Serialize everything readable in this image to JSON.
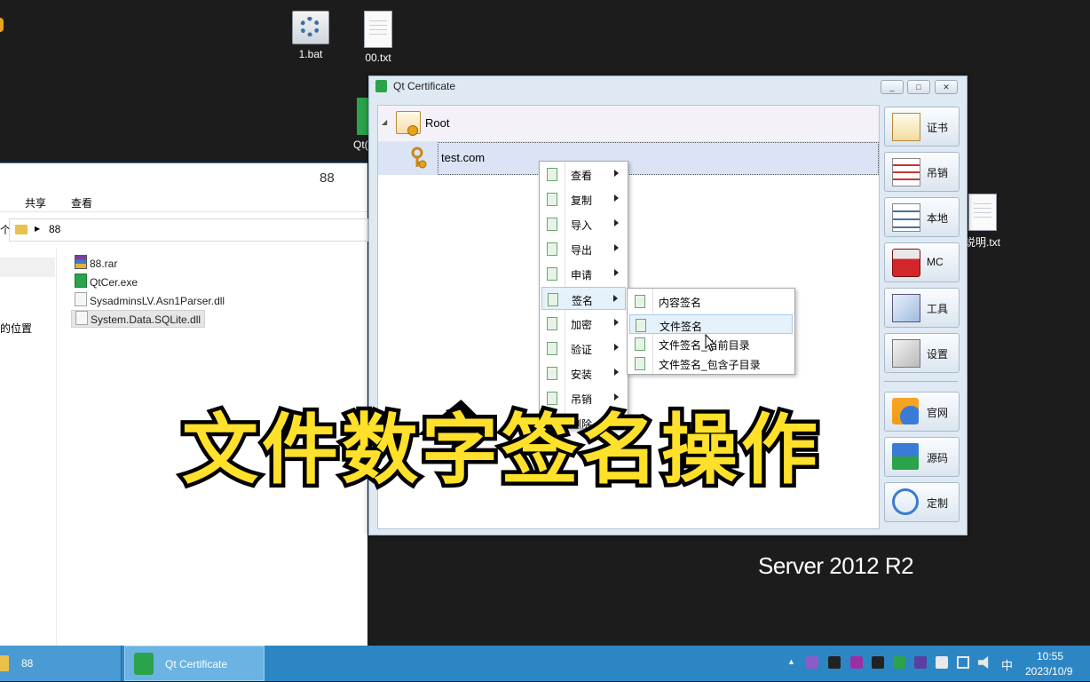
{
  "desktop": {
    "icons": [
      {
        "label": "1.bat"
      },
      {
        "label": "00.txt"
      },
      {
        "label": "Qt("
      },
      {
        "label": "说明.txt"
      }
    ],
    "server_edition": "Server 2012 R2"
  },
  "explorer": {
    "title": "88",
    "ribbon_tabs": [
      "共享",
      "查看"
    ],
    "address_path": "88",
    "nav_prefix": "个",
    "nav_item": "的位置",
    "files": [
      "88.rar",
      "QtCer.exe",
      "SysadminsLV.Asn1Parser.dll",
      "System.Data.SQLite.dll"
    ]
  },
  "qt_window": {
    "title": "Qt Certificate",
    "window_buttons": {
      "minimize": "_",
      "maximize": "□",
      "close": "✕"
    },
    "tree": {
      "root_label": "Root",
      "child_label": "test.com"
    },
    "toolbar": [
      "证书",
      "吊销",
      "本地",
      "MC",
      "工具",
      "设置",
      "官网",
      "源码",
      "定制"
    ]
  },
  "context_menu": {
    "items": [
      "查看",
      "复制",
      "导入",
      "导出",
      "申请",
      "签名",
      "加密",
      "验证",
      "安装",
      "吊销",
      "删除"
    ],
    "highlighted": "签名"
  },
  "submenu": {
    "items": [
      "内容签名",
      "文件签名",
      "文件签名_当前目录",
      "文件签名_包含子目录"
    ],
    "highlighted": "文件签名"
  },
  "overlay_caption": "文件数字签名操作",
  "taskbar": {
    "items": [
      {
        "label": "88"
      },
      {
        "label": "Qt Certificate"
      }
    ],
    "ime": "中",
    "time": "10:55",
    "date": "2023/10/9"
  }
}
